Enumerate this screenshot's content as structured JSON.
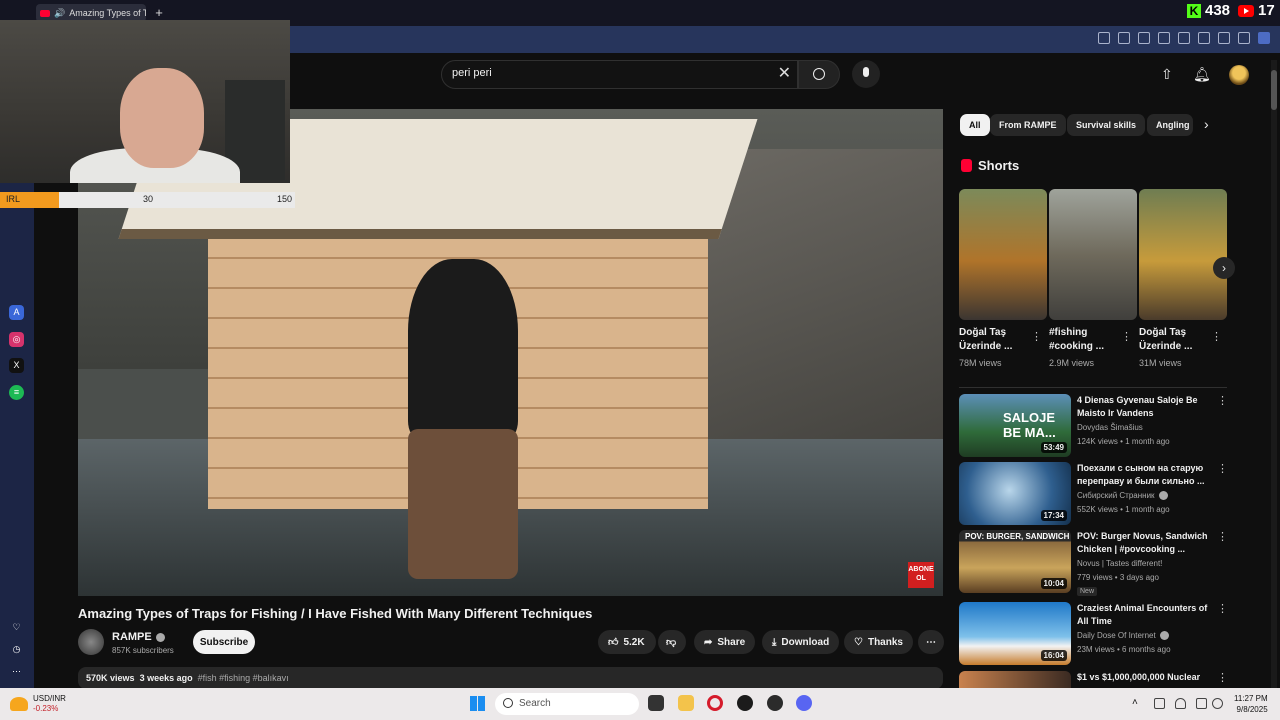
{
  "browser": {
    "tab_title": "Amazing Types of Trap",
    "new_tab": "+"
  },
  "stream_stats": {
    "kick_viewers": "438",
    "youtube_viewers": "17"
  },
  "irl_bar": {
    "label": "IRL",
    "current": "30",
    "goal": "150",
    "progress_fraction": 0.2
  },
  "search": {
    "value": "peri peri"
  },
  "video": {
    "badge": "ABONE OL",
    "title": "Amazing Types of Traps for Fishing / I Have Fished With Many Different Techniques",
    "channel": "RAMPE",
    "subscribers": "857K subscribers",
    "subscribe_label": "Subscribe",
    "likes": "5.2K",
    "share_label": "Share",
    "download_label": "Download",
    "thanks_label": "Thanks",
    "views": "570K views",
    "age": "3 weeks ago",
    "tags": "#fish #fishing #balıkavı"
  },
  "chips": [
    "All",
    "From RAMPE",
    "Survival skills",
    "Angling"
  ],
  "shorts": {
    "heading": "Shorts",
    "items": [
      {
        "title": "Doğal Taş Üzerinde ...",
        "views": "78M views"
      },
      {
        "title": "#fishing #cooking ...",
        "views": "2.9M views"
      },
      {
        "title": "Doğal Taş Üzerinde ...",
        "views": "31M views"
      }
    ]
  },
  "recommendations": [
    {
      "title": "4 Dienas Gyvenau Saloje Be Maisto Ir Vandens",
      "channel": "Dovydas Šimašius",
      "meta": "124K views • 1 month ago",
      "duration": "53:49",
      "thumb_text": "SALOJE BE MA..."
    },
    {
      "title": "Поехали с сыном на старую переправу и были сильно ...",
      "channel": "Сибирский Странник",
      "meta": "552K views • 1 month ago",
      "duration": "17:34",
      "thumb_text": ""
    },
    {
      "title": "POV: Burger Novus, Sandwich Chicken | #povcooking ...",
      "channel": "Novus | Tastes different!",
      "meta": "779 views • 3 days ago",
      "duration": "10:04",
      "thumb_text": "POV: BURGER, SANDWICH",
      "badge": "New"
    },
    {
      "title": "Craziest Animal Encounters of All Time",
      "channel": "Daily Dose Of Internet",
      "meta": "23M views • 6 months ago",
      "duration": "16:04",
      "thumb_text": ""
    },
    {
      "title": "$1 vs $1,000,000,000 Nuclear",
      "channel": "",
      "meta": "",
      "duration": "",
      "thumb_text": ""
    }
  ],
  "taskbar": {
    "ticker": "USD/INR",
    "change": "-0.23%",
    "search_label": "Search",
    "time": "11:27 PM",
    "date": "9/8/2025"
  }
}
